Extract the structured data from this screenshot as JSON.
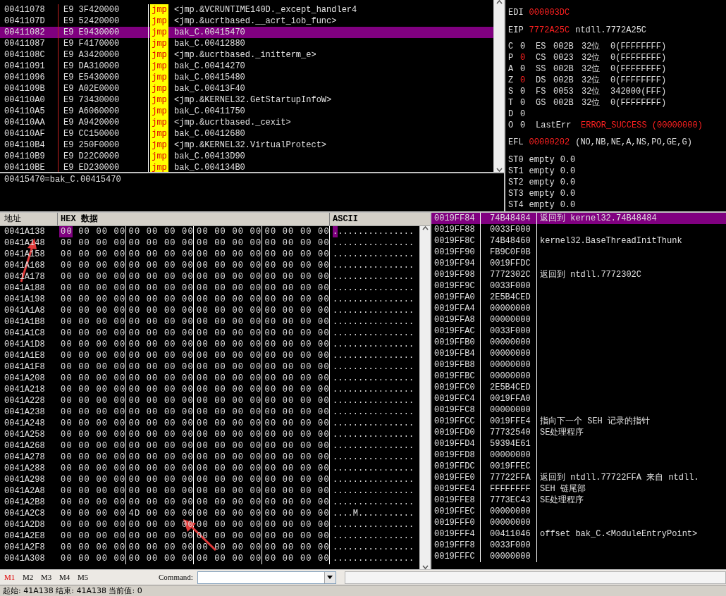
{
  "disassembly": {
    "rows": [
      {
        "address": "00411078",
        "bytes": "E9 3F420000",
        "mnemonic": "jmp",
        "operand": "<jmp.&VCRUNTIME140D._except_handler4",
        "selected": false
      },
      {
        "address": "0041107D",
        "bytes": "E9 52420000",
        "mnemonic": "jmp",
        "operand": "<jmp.&ucrtbased.__acrt_iob_func>",
        "selected": false
      },
      {
        "address": "00411082",
        "bytes": "E9 E9430000",
        "mnemonic": "jmp",
        "operand": "bak_C.00415470",
        "selected": true
      },
      {
        "address": "00411087",
        "bytes": "E9 F4170000",
        "mnemonic": "jmp",
        "operand": "bak_C.00412880",
        "selected": false
      },
      {
        "address": "0041108C",
        "bytes": "E9 A3420000",
        "mnemonic": "jmp",
        "operand": "<jmp.&ucrtbased._initterm_e>",
        "selected": false
      },
      {
        "address": "00411091",
        "bytes": "E9 DA310000",
        "mnemonic": "jmp",
        "operand": "bak_C.00414270",
        "selected": false
      },
      {
        "address": "00411096",
        "bytes": "E9 E5430000",
        "mnemonic": "jmp",
        "operand": "bak_C.00415480",
        "selected": false
      },
      {
        "address": "0041109B",
        "bytes": "E9 A02E0000",
        "mnemonic": "jmp",
        "operand": "bak_C.00413F40",
        "selected": false
      },
      {
        "address": "004110A0",
        "bytes": "E9 73430000",
        "mnemonic": "jmp",
        "operand": "<jmp.&KERNEL32.GetStartupInfoW>",
        "selected": false
      },
      {
        "address": "004110A5",
        "bytes": "E9 A6060000",
        "mnemonic": "jmp",
        "operand": "bak_C.00411750",
        "selected": false
      },
      {
        "address": "004110AA",
        "bytes": "E9 A9420000",
        "mnemonic": "jmp",
        "operand": "<jmp.&ucrtbased._cexit>",
        "selected": false
      },
      {
        "address": "004110AF",
        "bytes": "E9 CC150000",
        "mnemonic": "jmp",
        "operand": "bak_C.00412680",
        "selected": false
      },
      {
        "address": "004110B4",
        "bytes": "E9 250F0000",
        "mnemonic": "jmp",
        "operand": "<jmp.&KERNEL32.VirtualProtect>",
        "selected": false
      },
      {
        "address": "004110B9",
        "bytes": "E9 D22C0000",
        "mnemonic": "jmp",
        "operand": "bak_C.00413D90",
        "selected": false
      },
      {
        "address": "004110BE",
        "bytes": "E9 ED230000",
        "mnemonic": "jmp",
        "operand": "bak_C.004134B0",
        "selected": false
      }
    ],
    "info_line": "00415470=bak_C.00415470"
  },
  "registers": {
    "regs": [
      {
        "name": "EDI",
        "value": "000003DC",
        "changed": true
      }
    ],
    "eip": {
      "name": "EIP",
      "value": "7772A25C",
      "changed": true,
      "comment": "ntdll.7772A25C"
    },
    "flags": [
      {
        "flag": "C",
        "value": "0",
        "changed": false,
        "segment": "ES",
        "selector": "002B",
        "bits": "32位",
        "base": "0(FFFFFFFF)"
      },
      {
        "flag": "P",
        "value": "0",
        "changed": true,
        "segment": "CS",
        "selector": "0023",
        "bits": "32位",
        "base": "0(FFFFFFFF)"
      },
      {
        "flag": "A",
        "value": "0",
        "changed": false,
        "segment": "SS",
        "selector": "002B",
        "bits": "32位",
        "base": "0(FFFFFFFF)"
      },
      {
        "flag": "Z",
        "value": "0",
        "changed": true,
        "segment": "DS",
        "selector": "002B",
        "bits": "32位",
        "base": "0(FFFFFFFF)"
      },
      {
        "flag": "S",
        "value": "0",
        "changed": false,
        "segment": "FS",
        "selector": "0053",
        "bits": "32位",
        "base": "342000(FFF)"
      },
      {
        "flag": "T",
        "value": "0",
        "changed": false,
        "segment": "GS",
        "selector": "002B",
        "bits": "32位",
        "base": "0(FFFFFFFF)"
      },
      {
        "flag": "D",
        "value": "0",
        "changed": false
      },
      {
        "flag": "O",
        "value": "0",
        "changed": false,
        "last_error_label": "LastErr",
        "last_error": "ERROR_SUCCESS (00000000)",
        "last_error_changed": true
      }
    ],
    "efl": {
      "name": "EFL",
      "value": "00000202",
      "changed": true,
      "comment": "(NO,NB,NE,A,NS,PO,GE,G)"
    },
    "fpu": [
      {
        "name": "ST0",
        "tag": "empty",
        "value": "0.0"
      },
      {
        "name": "ST1",
        "tag": "empty",
        "value": "0.0"
      },
      {
        "name": "ST2",
        "tag": "empty",
        "value": "0.0"
      },
      {
        "name": "ST3",
        "tag": "empty",
        "value": "0.0"
      },
      {
        "name": "ST4",
        "tag": "empty",
        "value": "0.0"
      }
    ]
  },
  "dump": {
    "columns": [
      "地址",
      "HEX 数据",
      "ASCII"
    ],
    "rows": [
      {
        "address": "0041A138",
        "hex": [
          "00 00 00 00",
          "00 00 00 00",
          "00 00 00 00",
          "00 00 00 00"
        ],
        "ascii": "................",
        "selected": true
      },
      {
        "address": "0041A148",
        "hex": [
          "00 00 00 00",
          "00 00 00 00",
          "00 00 00 00",
          "00 00 00 00"
        ],
        "ascii": "................",
        "selected": false
      },
      {
        "address": "0041A158",
        "hex": [
          "00 00 00 00",
          "00 00 00 00",
          "00 00 00 00",
          "00 00 00 00"
        ],
        "ascii": "................",
        "selected": false
      },
      {
        "address": "0041A168",
        "hex": [
          "00 00 00 00",
          "00 00 00 00",
          "00 00 00 00",
          "00 00 00 00"
        ],
        "ascii": "................",
        "selected": false
      },
      {
        "address": "0041A178",
        "hex": [
          "00 00 00 00",
          "00 00 00 00",
          "00 00 00 00",
          "00 00 00 00"
        ],
        "ascii": "................",
        "selected": false
      },
      {
        "address": "0041A188",
        "hex": [
          "00 00 00 00",
          "00 00 00 00",
          "00 00 00 00",
          "00 00 00 00"
        ],
        "ascii": "................",
        "selected": false
      },
      {
        "address": "0041A198",
        "hex": [
          "00 00 00 00",
          "00 00 00 00",
          "00 00 00 00",
          "00 00 00 00"
        ],
        "ascii": "................",
        "selected": false
      },
      {
        "address": "0041A1A8",
        "hex": [
          "00 00 00 00",
          "00 00 00 00",
          "00 00 00 00",
          "00 00 00 00"
        ],
        "ascii": "................",
        "selected": false
      },
      {
        "address": "0041A1B8",
        "hex": [
          "00 00 00 00",
          "00 00 00 00",
          "00 00 00 00",
          "00 00 00 00"
        ],
        "ascii": "................",
        "selected": false
      },
      {
        "address": "0041A1C8",
        "hex": [
          "00 00 00 00",
          "00 00 00 00",
          "00 00 00 00",
          "00 00 00 00"
        ],
        "ascii": "................",
        "selected": false
      },
      {
        "address": "0041A1D8",
        "hex": [
          "00 00 00 00",
          "00 00 00 00",
          "00 00 00 00",
          "00 00 00 00"
        ],
        "ascii": "................",
        "selected": false
      },
      {
        "address": "0041A1E8",
        "hex": [
          "00 00 00 00",
          "00 00 00 00",
          "00 00 00 00",
          "00 00 00 00"
        ],
        "ascii": "................",
        "selected": false
      },
      {
        "address": "0041A1F8",
        "hex": [
          "00 00 00 00",
          "00 00 00 00",
          "00 00 00 00",
          "00 00 00 00"
        ],
        "ascii": "................",
        "selected": false
      },
      {
        "address": "0041A208",
        "hex": [
          "00 00 00 00",
          "00 00 00 00",
          "00 00 00 00",
          "00 00 00 00"
        ],
        "ascii": "................",
        "selected": false
      },
      {
        "address": "0041A218",
        "hex": [
          "00 00 00 00",
          "00 00 00 00",
          "00 00 00 00",
          "00 00 00 00"
        ],
        "ascii": "................",
        "selected": false
      },
      {
        "address": "0041A228",
        "hex": [
          "00 00 00 00",
          "00 00 00 00",
          "00 00 00 00",
          "00 00 00 00"
        ],
        "ascii": "................",
        "selected": false
      },
      {
        "address": "0041A238",
        "hex": [
          "00 00 00 00",
          "00 00 00 00",
          "00 00 00 00",
          "00 00 00 00"
        ],
        "ascii": "................",
        "selected": false
      },
      {
        "address": "0041A248",
        "hex": [
          "00 00 00 00",
          "00 00 00 00",
          "00 00 00 00",
          "00 00 00 00"
        ],
        "ascii": "................",
        "selected": false
      },
      {
        "address": "0041A258",
        "hex": [
          "00 00 00 00",
          "00 00 00 00",
          "00 00 00 00",
          "00 00 00 00"
        ],
        "ascii": "................",
        "selected": false
      },
      {
        "address": "0041A268",
        "hex": [
          "00 00 00 00",
          "00 00 00 00",
          "00 00 00 00",
          "00 00 00 00"
        ],
        "ascii": "................",
        "selected": false
      },
      {
        "address": "0041A278",
        "hex": [
          "00 00 00 00",
          "00 00 00 00",
          "00 00 00 00",
          "00 00 00 00"
        ],
        "ascii": "................",
        "selected": false
      },
      {
        "address": "0041A288",
        "hex": [
          "00 00 00 00",
          "00 00 00 00",
          "00 00 00 00",
          "00 00 00 00"
        ],
        "ascii": "................",
        "selected": false
      },
      {
        "address": "0041A298",
        "hex": [
          "00 00 00 00",
          "00 00 00 00",
          "00 00 00 00",
          "00 00 00 00"
        ],
        "ascii": "................",
        "selected": false
      },
      {
        "address": "0041A2A8",
        "hex": [
          "00 00 00 00",
          "00 00 00 00",
          "00 00 00 00",
          "00 00 00 00"
        ],
        "ascii": "................",
        "selected": false
      },
      {
        "address": "0041A2B8",
        "hex": [
          "00 00 00 00",
          "00 00 00 00",
          "00 00 00 00",
          "00 00 00 00"
        ],
        "ascii": "................",
        "selected": false
      },
      {
        "address": "0041A2C8",
        "hex": [
          "00 00 00 00",
          "4D 00 00 00",
          "00 00 00 00",
          "00 00 00 00"
        ],
        "ascii": "....M...........",
        "selected": false
      },
      {
        "address": "0041A2D8",
        "hex": [
          "00 00 00 00",
          "00 00 00 00",
          "00 00 00 00",
          "00 00 00 00"
        ],
        "ascii": "................",
        "selected": false
      },
      {
        "address": "0041A2E8",
        "hex": [
          "00 00 00 00",
          "00 00 00 00",
          "00 00 00 00",
          "00 00 00 00"
        ],
        "ascii": "................",
        "selected": false
      },
      {
        "address": "0041A2F8",
        "hex": [
          "00 00 00 00",
          "00 00 00 00",
          "00 00 00 00",
          "00 00 00 00"
        ],
        "ascii": "................",
        "selected": false
      },
      {
        "address": "0041A308",
        "hex": [
          "00 00 00 00",
          "00 00 00 00",
          "00 00 00 00",
          "00 00 00 00"
        ],
        "ascii": "................",
        "selected": false
      }
    ]
  },
  "stack": {
    "rows": [
      {
        "address": "0019FF84",
        "value": "74B48484",
        "comment": "返回到 kernel32.74B48484",
        "selected": true
      },
      {
        "address": "0019FF88",
        "value": "0033F000",
        "selected": false
      },
      {
        "address": "0019FF8C",
        "value": "74B48460",
        "comment": "kernel32.BaseThreadInitThunk",
        "selected": false
      },
      {
        "address": "0019FF90",
        "value": "FB9C0F0B",
        "selected": false
      },
      {
        "address": "0019FF94",
        "value": "0019FFDC",
        "selected": false
      },
      {
        "address": "0019FF98",
        "value": "7772302C",
        "comment": "返回到 ntdll.7772302C",
        "selected": false
      },
      {
        "address": "0019FF9C",
        "value": "0033F000",
        "selected": false
      },
      {
        "address": "0019FFA0",
        "value": "2E5B4CED",
        "selected": false
      },
      {
        "address": "0019FFA4",
        "value": "00000000",
        "selected": false
      },
      {
        "address": "0019FFA8",
        "value": "00000000",
        "selected": false
      },
      {
        "address": "0019FFAC",
        "value": "0033F000",
        "selected": false
      },
      {
        "address": "0019FFB0",
        "value": "00000000",
        "selected": false
      },
      {
        "address": "0019FFB4",
        "value": "00000000",
        "selected": false
      },
      {
        "address": "0019FFB8",
        "value": "00000000",
        "selected": false
      },
      {
        "address": "0019FFBC",
        "value": "00000000",
        "selected": false
      },
      {
        "address": "0019FFC0",
        "value": "2E5B4CED",
        "selected": false
      },
      {
        "address": "0019FFC4",
        "value": "0019FFA0",
        "selected": false
      },
      {
        "address": "0019FFC8",
        "value": "00000000",
        "selected": false
      },
      {
        "address": "0019FFCC",
        "value": "0019FFE4",
        "comment": "指向下一个 SEH 记录的指针",
        "selected": false
      },
      {
        "address": "0019FFD0",
        "value": "77732540",
        "comment": "SE处理程序",
        "selected": false
      },
      {
        "address": "0019FFD4",
        "value": "59394E61",
        "selected": false
      },
      {
        "address": "0019FFD8",
        "value": "00000000",
        "selected": false
      },
      {
        "address": "0019FFDC",
        "value": "0019FFEC",
        "selected": false
      },
      {
        "address": "0019FFE0",
        "value": "77722FFA",
        "comment": "返回到 ntdll.77722FFA 来自 ntdll.",
        "selected": false
      },
      {
        "address": "0019FFE4",
        "value": "FFFFFFFF",
        "comment": "SEH 链尾部",
        "selected": false
      },
      {
        "address": "0019FFE8",
        "value": "7773EC43",
        "comment": "SE处理程序",
        "selected": false
      },
      {
        "address": "0019FFEC",
        "value": "00000000",
        "selected": false
      },
      {
        "address": "0019FFF0",
        "value": "00000000",
        "selected": false
      },
      {
        "address": "0019FFF4",
        "value": "00411046",
        "comment": "offset bak_C.<ModuleEntryPoint>",
        "selected": false
      },
      {
        "address": "0019FFF8",
        "value": "0033F000",
        "selected": false
      },
      {
        "address": "0019FFFC",
        "value": "00000000",
        "selected": false
      }
    ]
  },
  "command_bar": {
    "tabs": [
      {
        "label": "M1",
        "selected": true
      },
      {
        "label": "M2",
        "selected": false
      },
      {
        "label": "M3",
        "selected": false
      },
      {
        "label": "M4",
        "selected": false
      },
      {
        "label": "M5",
        "selected": false
      }
    ],
    "command_label": "Command:"
  },
  "status_bar": "起始: 41A138  结束: 41A138  当前值: 0"
}
